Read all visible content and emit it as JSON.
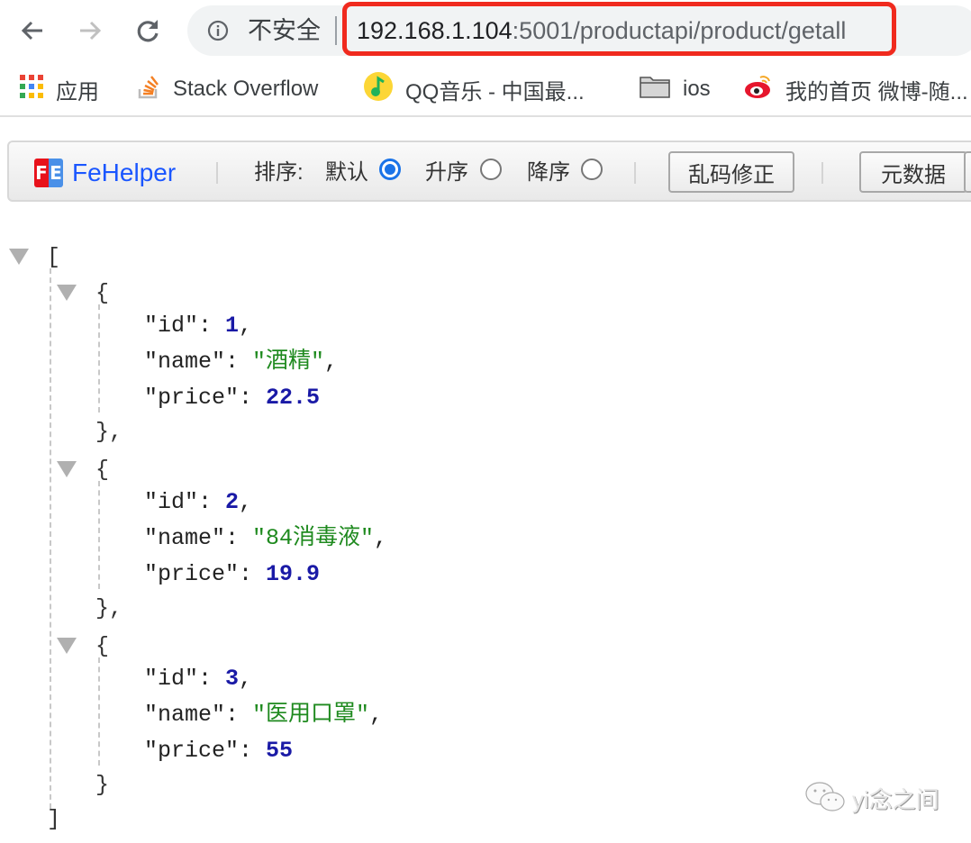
{
  "browser": {
    "security_label": "不安全",
    "url_host": "192.168.1.104",
    "url_path": ":5001/productapi/product/getall",
    "nav": {
      "back": "back-arrow",
      "forward": "forward-arrow",
      "reload": "reload"
    }
  },
  "bookmarks": [
    {
      "label": "应用",
      "icon": "apps-grid"
    },
    {
      "label": "Stack Overflow",
      "icon": "stackoverflow"
    },
    {
      "label": "QQ音乐 - 中国最...",
      "icon": "qq-music"
    },
    {
      "label": "ios",
      "icon": "folder"
    },
    {
      "label": "我的首页 微博-随...",
      "icon": "weibo"
    }
  ],
  "fehelper": {
    "logo_badge_left": "F",
    "logo_badge_right": "E",
    "name": "FeHelper",
    "sort_label": "排序:",
    "sort_options": [
      {
        "label": "默认",
        "selected": true
      },
      {
        "label": "升序",
        "selected": false
      },
      {
        "label": "降序",
        "selected": false
      }
    ],
    "fix_encoding_button": "乱码修正",
    "metadata_button": "元数据",
    "colors": {
      "brand": "#1a56ff",
      "badge_red": "#e8121b",
      "badge_blue": "#4a90e8"
    }
  },
  "json_view": {
    "open_bracket": "[",
    "close_bracket": "]",
    "items": [
      {
        "id": "1",
        "name": "\"酒精\"",
        "price": "22.5",
        "close": "},"
      },
      {
        "id": "2",
        "name": "\"84消毒液\"",
        "price": "19.9",
        "close": "},"
      },
      {
        "id": "3",
        "name": "\"医用口罩\"",
        "price": "55",
        "close": "}"
      }
    ],
    "keys": {
      "id": "\"id\": ",
      "name": "\"name\": ",
      "price": "\"price\": "
    }
  },
  "watermark": {
    "text": "yi念之间",
    "icon": "wechat"
  }
}
